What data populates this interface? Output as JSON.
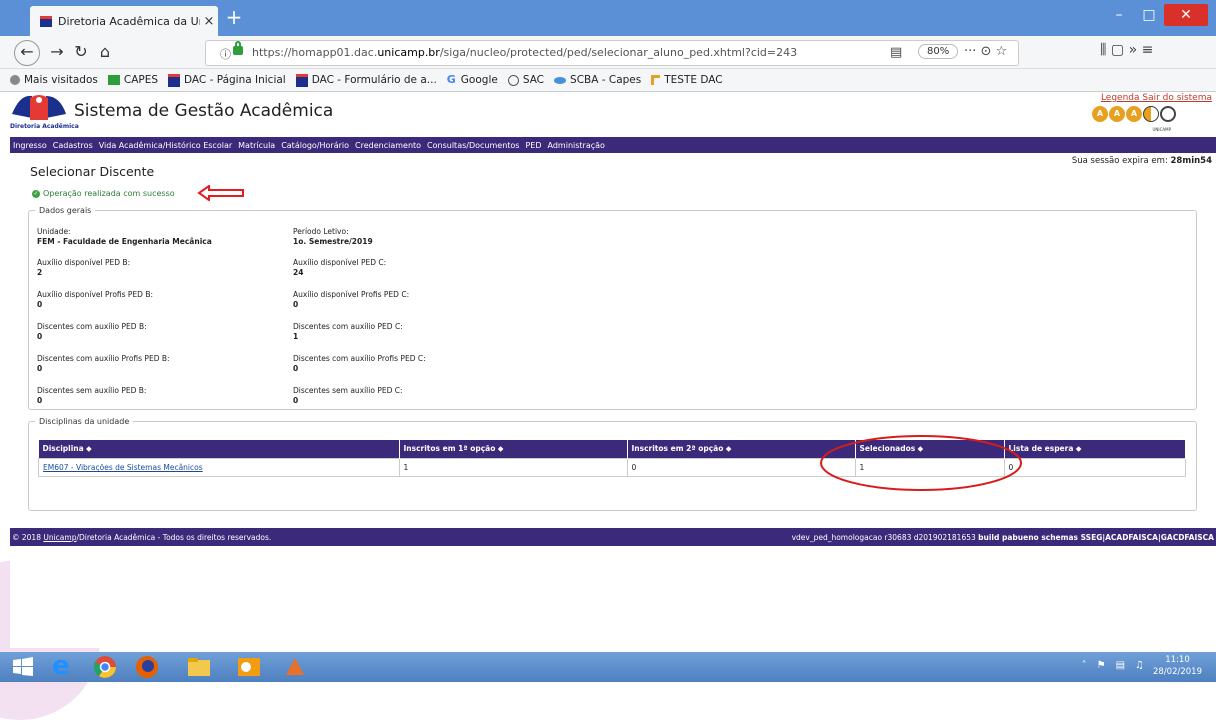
{
  "browser": {
    "tab_title": "Diretoria Acadêmica da Unican",
    "tab_close": "×",
    "new_tab": "+",
    "url_prefix": "https://homapp01.dac.",
    "url_domain": "unicamp.br",
    "url_suffix": "/siga/nucleo/protected/ped/selecionar_aluno_ped.xhtml?cid=243",
    "zoom": "80%",
    "page_actions": "··· ⊙ ☆",
    "right_icons": "⫼  ▢  »  ≡",
    "bookmarks": [
      {
        "label": "Mais visitados",
        "color": "#888888"
      },
      {
        "label": "CAPES",
        "color": "#2e9e3a"
      },
      {
        "label": "DAC - Página Inicial",
        "color": "#1c2f8c"
      },
      {
        "label": "DAC - Formulário de a...",
        "color": "#1c2f8c"
      },
      {
        "label": "Google",
        "color": "#4285f4"
      },
      {
        "label": "SAC",
        "color": "#555555"
      },
      {
        "label": "SCBA - Capes",
        "color": "#4a90d9"
      },
      {
        "label": "TESTE DAC",
        "color": "#e8a021"
      }
    ]
  },
  "header": {
    "system_title": "Sistema de Gestão Acadêmica",
    "logo_caption": "Diretoria Acadêmica",
    "links": "Legenda Sair do sistema",
    "unicamp_caption": "UNICAMP"
  },
  "menu": [
    "Ingresso",
    "Cadastros",
    "Vida Acadêmica/Histórico Escolar",
    "Matrícula",
    "Catálogo/Horário",
    "Credenciamento",
    "Consultas/Documentos",
    "PED",
    "Administração"
  ],
  "session": {
    "label": "Sua sessão expira em:",
    "value": "28min54"
  },
  "page_title": "Selecionar Discente",
  "success_message": "Operação realizada com sucesso",
  "dados_gerais": {
    "legend": "Dados gerais",
    "left": [
      {
        "label": "Unidade:",
        "value": "FEM - Faculdade de Engenharia Mecânica"
      },
      {
        "label": "Auxílio disponível PED B:",
        "value": "2"
      },
      {
        "label": "Auxílio disponível Profis PED B:",
        "value": "0"
      },
      {
        "label": "Discentes com auxílio PED B:",
        "value": "0"
      },
      {
        "label": "Discentes com auxílio Profis PED B:",
        "value": "0"
      },
      {
        "label": "Discentes sem auxílio PED B:",
        "value": "0"
      }
    ],
    "right": [
      {
        "label": "Período Letivo:",
        "value": "1o. Semestre/2019"
      },
      {
        "label": "Auxílio disponível PED C:",
        "value": "24"
      },
      {
        "label": "Auxílio disponível Profis PED C:",
        "value": "0"
      },
      {
        "label": "Discentes com auxílio PED C:",
        "value": "1"
      },
      {
        "label": "Discentes com auxílio Profis PED C:",
        "value": "0"
      },
      {
        "label": "Discentes sem auxílio PED C:",
        "value": "0"
      }
    ]
  },
  "disciplinas": {
    "legend": "Disciplinas da unidade",
    "columns": [
      "Disciplina ⬥",
      "Inscritos em 1ª opção ⬥",
      "Inscritos em 2ª opção ⬥",
      "Selecionados ⬥",
      "Lista de espera ⬥"
    ],
    "rows": [
      [
        "EM607 - Vibrações de Sistemas Mecânicos",
        "1",
        "0",
        "1",
        "0"
      ]
    ]
  },
  "footer": {
    "copyright_pre": "© 2018 ",
    "copyright_link": "Unicamp",
    "copyright_post": "/Diretoria Acadêmica - Todos os direitos reservados.",
    "build_plain": "vdev_ped_homologacao r30683 d201902181653 ",
    "build_bold": "build pabueno schemas SSEG|ACADFAISCA|GACDFAISCA"
  },
  "taskbar": {
    "time": "11:10",
    "date": "28/02/2019"
  }
}
